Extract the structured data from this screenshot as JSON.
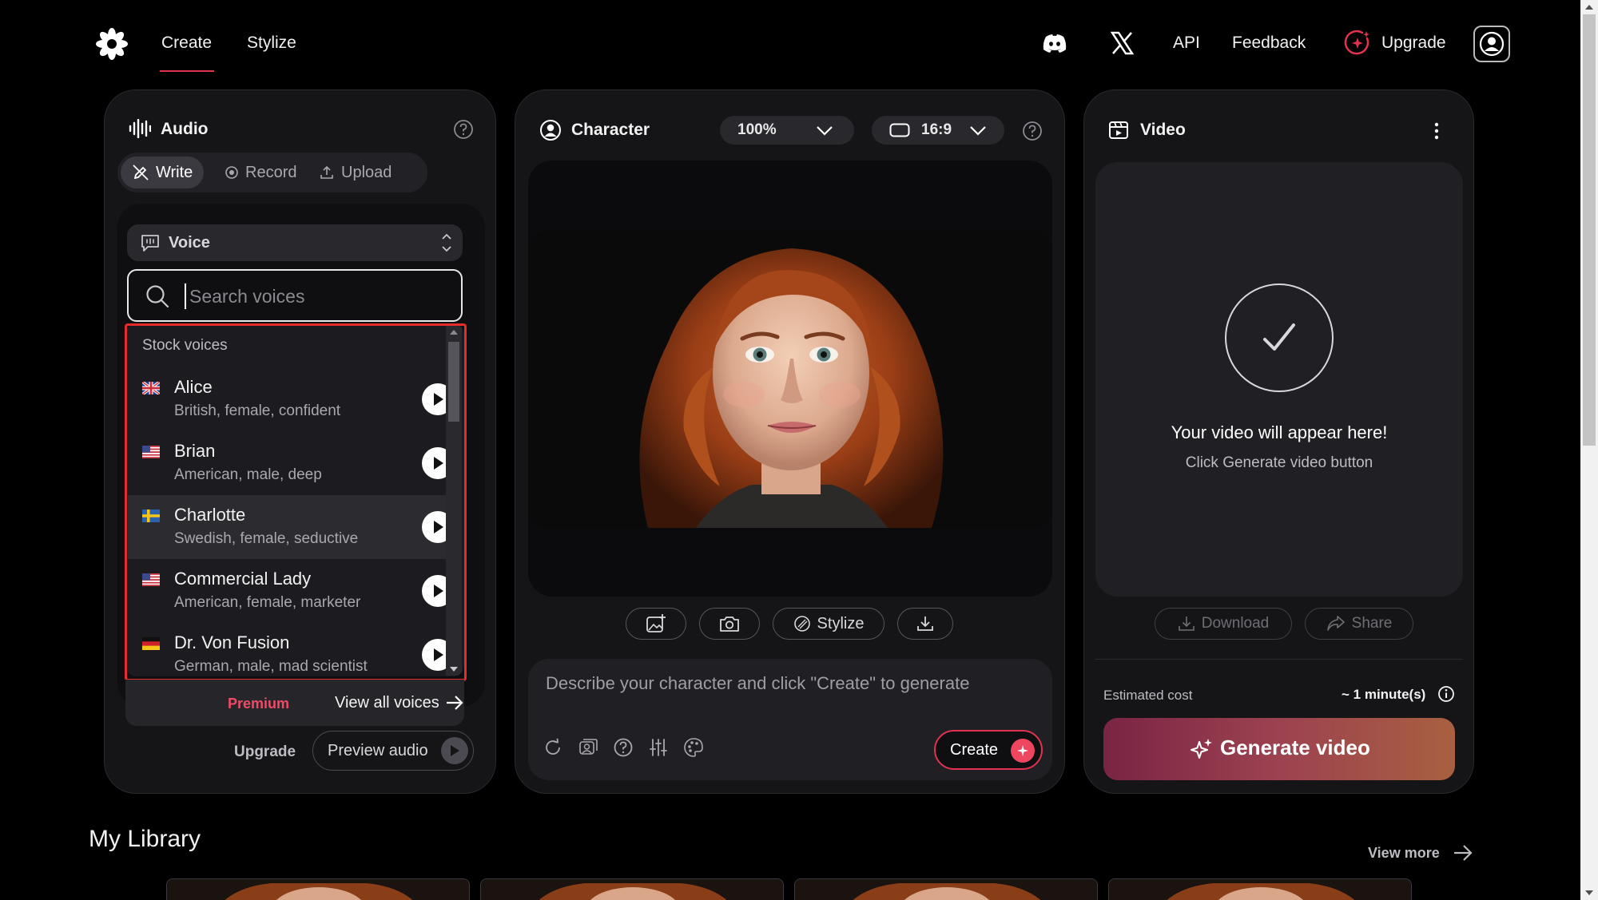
{
  "nav": {
    "create": "Create",
    "stylize": "Stylize",
    "api": "API",
    "feedback": "Feedback",
    "upgrade": "Upgrade"
  },
  "audio": {
    "title": "Audio",
    "tabs": {
      "write": "Write",
      "record": "Record",
      "upload": "Upload"
    },
    "voice_select": "Voice",
    "search_placeholder": "Search voices",
    "dropdown_header": "Stock voices",
    "voices": [
      {
        "name": "Alice",
        "desc": "British, female, confident",
        "flag": "GB"
      },
      {
        "name": "Brian",
        "desc": "American, male, deep",
        "flag": "US"
      },
      {
        "name": "Charlotte",
        "desc": "Swedish, female, seductive",
        "flag": "SE"
      },
      {
        "name": "Commercial Lady",
        "desc": "American, female, marketer",
        "flag": "US"
      },
      {
        "name": "Dr. Von Fusion",
        "desc": "German, male, mad scientist",
        "flag": "DE"
      }
    ],
    "premium": "Premium",
    "view_all": "View all voices",
    "upgrade": "Upgrade",
    "preview": "Preview audio"
  },
  "character": {
    "title": "Character",
    "zoom": "100%",
    "ratio": "16:9",
    "stylize": "Stylize",
    "prompt_placeholder": "Describe your character and click \"Create\" to generate",
    "create": "Create"
  },
  "video": {
    "title": "Video",
    "message": "Your video will appear here!",
    "sub": "Click Generate video button",
    "download": "Download",
    "share": "Share",
    "est_label": "Estimated cost",
    "est_value": "~ 1 minute(s)",
    "generate": "Generate video"
  },
  "library": {
    "title": "My Library",
    "view_more": "View more"
  },
  "colors": {
    "accent": "#e1334f",
    "highlight_outline": "#e52b2b",
    "premium": "#f04a66"
  }
}
